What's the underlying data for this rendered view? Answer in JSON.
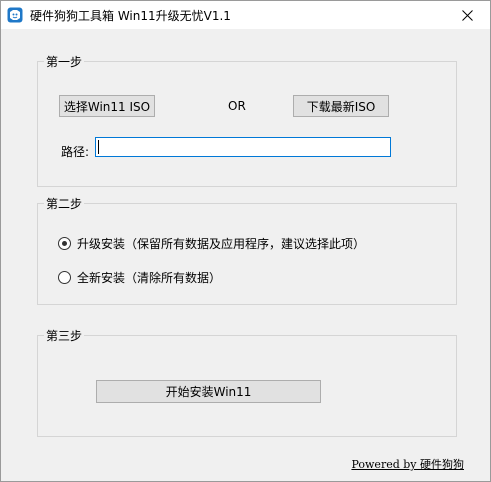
{
  "window": {
    "title": "硬件狗狗工具箱 Win11升级无忧V1.1"
  },
  "step1": {
    "label": "第一步",
    "select_iso_button": "选择Win11 ISO",
    "or_text": "OR",
    "download_iso_button": "下载最新ISO",
    "path_label": "路径:",
    "path_value": ""
  },
  "step2": {
    "label": "第二步",
    "options": [
      {
        "label": "升级安装（保留所有数据及应用程序，建议选择此项）",
        "checked": true
      },
      {
        "label": "全新安装（清除所有数据）",
        "checked": false
      }
    ]
  },
  "step3": {
    "label": "第三步",
    "start_button": "开始安装Win11"
  },
  "footer": {
    "powered_by": "Powered by 硬件狗狗"
  },
  "colors": {
    "accent": "#0078d7",
    "window_bg": "#f0f0f0",
    "button_bg": "#e1e1e1"
  }
}
